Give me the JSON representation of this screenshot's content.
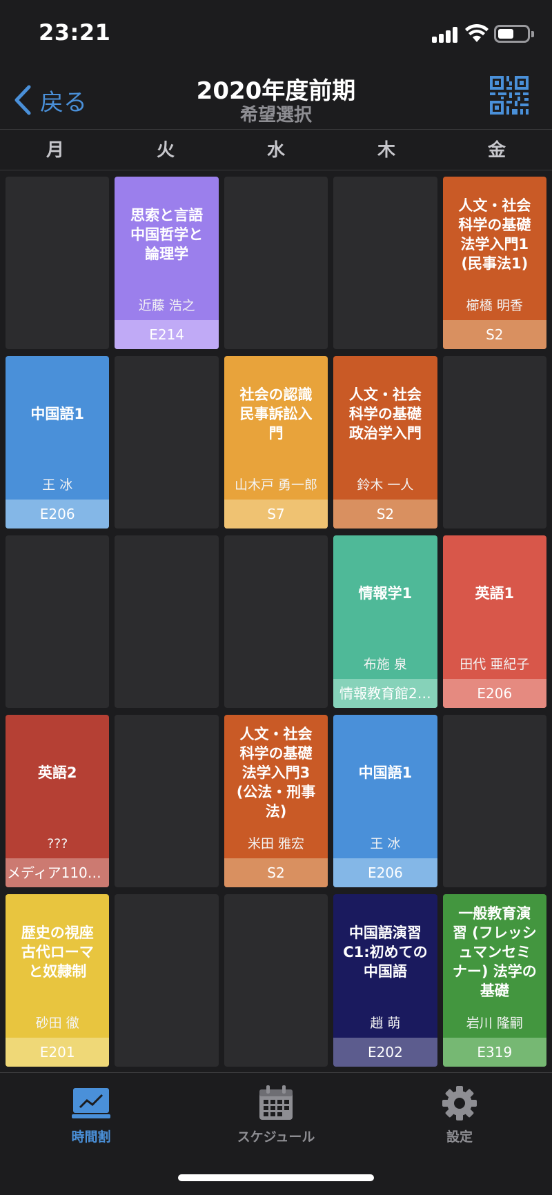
{
  "status_bar": {
    "time": "23:21"
  },
  "nav": {
    "back_label": "戻る",
    "title": "2020年度前期",
    "subtitle": "希望選択"
  },
  "days": [
    "月",
    "火",
    "水",
    "木",
    "金"
  ],
  "colors": {
    "accent": "#4a90d9",
    "empty_cell": "#2c2c2e",
    "background": "#1c1c1e"
  },
  "grid": [
    [
      null,
      {
        "title": "思索と言語\n中国哲学と\n論理学",
        "teacher": "近藤 浩之",
        "room": "E214",
        "color": "#9b7fec",
        "room_color": "#c0aaf6"
      },
      null,
      null,
      {
        "title": "人文・社会\n科学の基礎\n法学入門1\n(民事法1)",
        "teacher": "櫛橋 明香",
        "room": "S2",
        "color": "#c95a26",
        "room_color": "#d99060"
      }
    ],
    [
      {
        "title": "中国語1",
        "teacher": "王 冰",
        "room": "E206",
        "color": "#4a90d9",
        "room_color": "#84b7e7"
      },
      null,
      {
        "title": "社会の認識\n民事訴訟入\n門",
        "teacher": "山木戸 勇一郎",
        "room": "S7",
        "color": "#e8a33b",
        "room_color": "#efc272"
      },
      {
        "title": "人文・社会\n科学の基礎\n政治学入門",
        "teacher": "鈴木 一人",
        "room": "S2",
        "color": "#c95a26",
        "room_color": "#d99060"
      },
      null
    ],
    [
      null,
      null,
      null,
      {
        "title": "情報学1",
        "teacher": "布施 泉",
        "room": "情報教育館2…",
        "color": "#4fb998",
        "room_color": "#86d2b9"
      },
      {
        "title": "英語1",
        "teacher": "田代 亜紀子",
        "room": "E206",
        "color": "#d8574a",
        "room_color": "#e58a80"
      }
    ],
    [
      {
        "title": "英語2",
        "teacher": "???",
        "room": "メディア110C…",
        "color": "#b54034",
        "room_color": "#cc7a71"
      },
      null,
      {
        "title": "人文・社会\n科学の基礎\n法学入門3\n(公法・刑事\n法)",
        "teacher": "米田 雅宏",
        "room": "S2",
        "color": "#c95a26",
        "room_color": "#d99060"
      },
      {
        "title": "中国語1",
        "teacher": "王 冰",
        "room": "E206",
        "color": "#4a90d9",
        "room_color": "#84b7e7"
      },
      null
    ],
    [
      {
        "title": "歴史の視座\n古代ローマ\nと奴隷制",
        "teacher": "砂田 徹",
        "room": "E201",
        "color": "#e8c53f",
        "room_color": "#efd877"
      },
      null,
      null,
      {
        "title": "中国語演習\nC1:初めての\n中国語",
        "teacher": "趙 萌",
        "room": "E202",
        "color": "#1a1a5e",
        "room_color": "#5c5c8e"
      },
      {
        "title": "一般教育演\n習 (フレッシ\nュマンセミ\nナー) 法学の\n基礎",
        "teacher": "岩川 隆嗣",
        "room": "E319",
        "color": "#43963f",
        "room_color": "#76b873"
      }
    ]
  ],
  "tabs": [
    {
      "label": "時間割",
      "icon": "timetable-icon",
      "active": true
    },
    {
      "label": "スケジュール",
      "icon": "calendar-icon",
      "active": false
    },
    {
      "label": "設定",
      "icon": "gear-icon",
      "active": false
    }
  ]
}
